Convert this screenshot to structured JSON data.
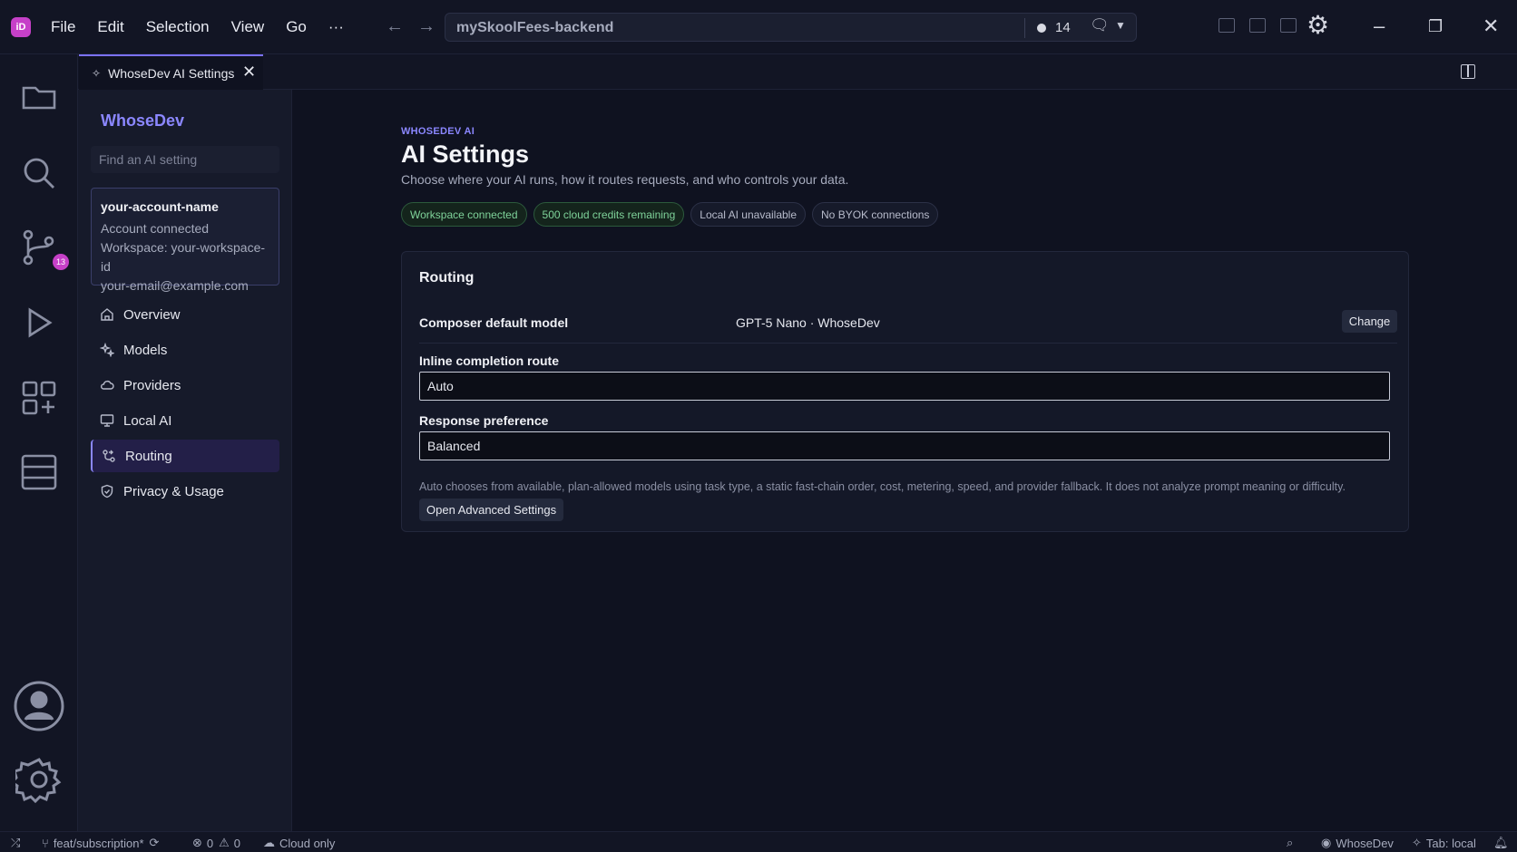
{
  "titlebar": {
    "logo_text": "iD",
    "menu": [
      "File",
      "Edit",
      "Selection",
      "View",
      "Go",
      "···"
    ],
    "command_center_title": "mySkoolFees-backend",
    "indicator_count": "14"
  },
  "activity_bar": {
    "scm_badge": "13",
    "icons": [
      "explorer-icon",
      "search-icon",
      "source-control-icon",
      "run-icon",
      "extensions-icon",
      "database-icon",
      "account-icon",
      "settings-gear-icon"
    ]
  },
  "tab": {
    "label": "WhoseDev AI Settings",
    "close": "✕"
  },
  "sidebar": {
    "brand": "WhoseDev",
    "search_placeholder": "Find an AI setting",
    "account": {
      "name": "your-account-name",
      "status": "Account connected",
      "workspace": "Workspace: your-workspace-id",
      "email": "your-email@example.com"
    },
    "nav": [
      {
        "label": "Overview",
        "icon": "home-icon"
      },
      {
        "label": "Models",
        "icon": "sparkle-icon"
      },
      {
        "label": "Providers",
        "icon": "cloud-icon"
      },
      {
        "label": "Local AI",
        "icon": "monitor-icon"
      },
      {
        "label": "Routing",
        "icon": "routing-icon",
        "active": true
      },
      {
        "label": "Privacy & Usage",
        "icon": "shield-icon"
      }
    ]
  },
  "main": {
    "eyebrow": "WHOSEDEV AI",
    "title": "AI Settings",
    "subtitle": "Choose where your AI runs, how it routes requests, and who controls your data.",
    "badges": [
      {
        "label": "Workspace connected",
        "tone": "ok"
      },
      {
        "label": "500 cloud credits remaining",
        "tone": "ok"
      },
      {
        "label": "Local AI unavailable",
        "tone": "neutral"
      },
      {
        "label": "No BYOK connections",
        "tone": "neutral"
      }
    ],
    "card": {
      "title": "Routing",
      "composer_label": "Composer default model",
      "composer_value": "GPT-5 Nano · WhoseDev",
      "change_label": "Change",
      "inline_label": "Inline completion route",
      "inline_value": "Auto",
      "response_label": "Response preference",
      "response_value": "Balanced",
      "help_text": "Auto chooses from available, plan-allowed models using task type, a static fast-chain order, cost, metering, speed, and provider fallback. It does not analyze prompt meaning or difficulty.",
      "advanced_label": "Open Advanced Settings"
    }
  },
  "statusbar": {
    "branch": "feat/subscription*",
    "errors": "0",
    "warnings": "0",
    "cloud": "Cloud only",
    "account": "WhoseDev",
    "tab_mode": "Tab: local"
  },
  "colors": {
    "accent": "#8b87ff",
    "brand_pink": "#c640c8",
    "ok_text": "#7fd39a",
    "background": "#0f1220"
  }
}
